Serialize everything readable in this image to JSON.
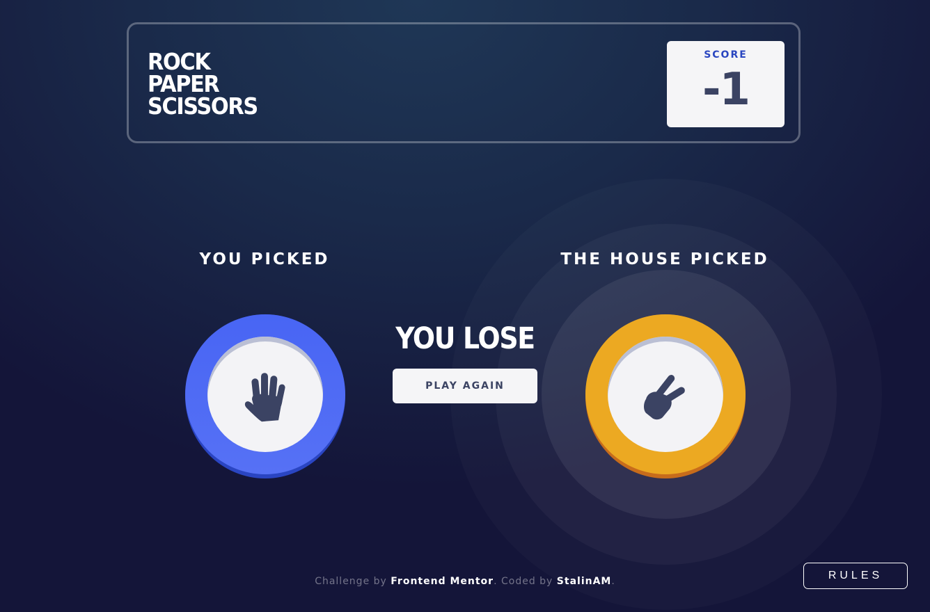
{
  "header": {
    "title_lines": [
      "ROCK",
      "PAPER",
      "SCISSORS"
    ],
    "score_label": "SCORE",
    "score_value": "-1"
  },
  "game": {
    "you_picked_label": "YOU PICKED",
    "house_picked_label": "THE HOUSE PICKED",
    "player_choice": "paper",
    "house_choice": "scissors",
    "result_text": "YOU LOSE",
    "play_again_label": "PLAY AGAIN",
    "winner": "house"
  },
  "footer": {
    "challenge_prefix": "Challenge by ",
    "challenge_link": "Frontend Mentor",
    "coded_prefix": ". Coded by ",
    "coded_link": "StalinAM",
    "suffix": ".",
    "rules_label": "RULES"
  },
  "colors": {
    "paper": "#4865f4",
    "scissors": "#eca922",
    "background": "#1f3756",
    "score_text": "#3b4363",
    "score_label": "#2a46c0"
  },
  "icons": {
    "player": "hand-paper-icon",
    "house": "hand-scissors-icon"
  }
}
